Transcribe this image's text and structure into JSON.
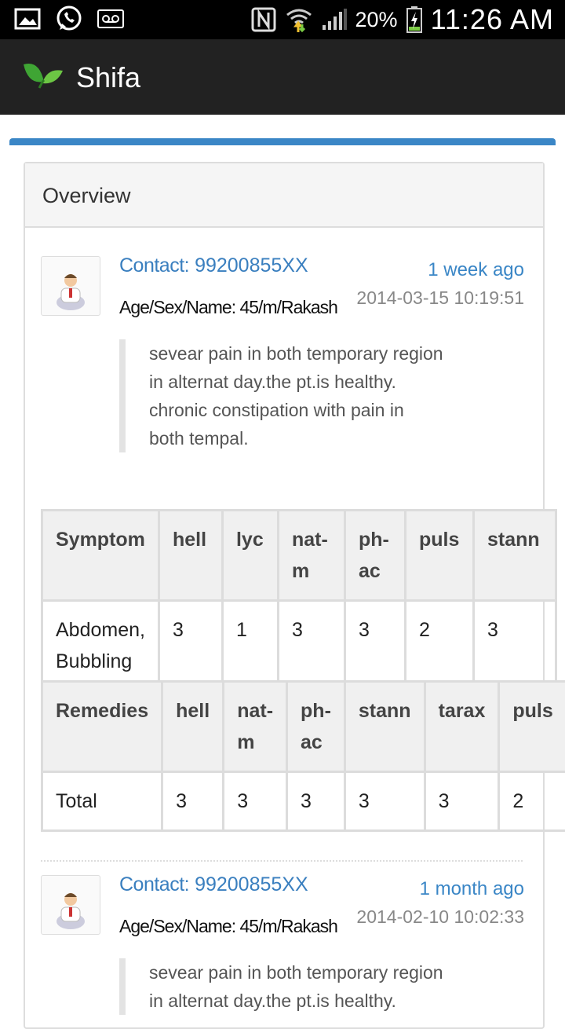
{
  "status_bar": {
    "icons_left": [
      "gallery-icon",
      "whatsapp-icon",
      "voicemail-icon"
    ],
    "icons_right": [
      "nfc-icon",
      "wifi-icon",
      "signal-icon",
      "battery-icon"
    ],
    "battery": "20%",
    "time": "11:26 AM"
  },
  "app_bar": {
    "title": "Shifa"
  },
  "overview": {
    "heading": "Overview"
  },
  "entries": [
    {
      "contact_label": "Contact:",
      "contact_value": "99200855XX",
      "age_sex_name": "Age/Sex/Name: 45/m/Rakash",
      "relative_time": "1 week ago",
      "datetime": "2014-03-15 10:19:51",
      "complaint_lines": [
        "sevear pain in both temporary region",
        "in alternat day.the pt.is healthy.",
        "chronic constipation with pain in",
        "both tempal."
      ]
    },
    {
      "contact_label": "Contact:",
      "contact_value": "99200855XX",
      "age_sex_name": "Age/Sex/Name: 45/m/Rakash",
      "relative_time": "1 month ago",
      "datetime": "2014-02-10 10:02:33",
      "complaint_lines": [
        "sevear pain in both temporary region",
        "in alternat day.the pt.is healthy."
      ]
    }
  ],
  "symptom_table": {
    "headers": [
      "Symptom",
      "hell",
      "lyc",
      "nat-\nm",
      "ph-\nac",
      "puls",
      "stann"
    ],
    "row": [
      "Abdomen,\nBubbling",
      "3",
      "1",
      "3",
      "3",
      "2",
      "3"
    ]
  },
  "remedies_table": {
    "headers": [
      "Remedies",
      "hell",
      "nat-\nm",
      "ph-\nac",
      "stann",
      "tarax",
      "puls"
    ],
    "row": [
      "Total",
      "3",
      "3",
      "3",
      "3",
      "3",
      "2"
    ]
  }
}
